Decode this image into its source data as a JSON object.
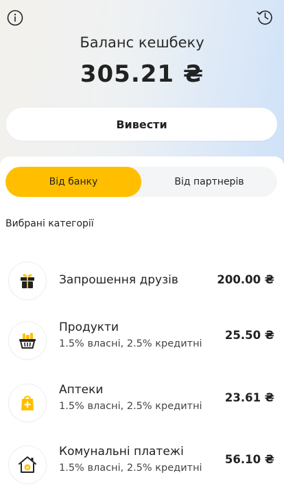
{
  "header": {
    "info_icon": "info-icon",
    "history_icon": "history-icon",
    "title": "Баланс кешбеку",
    "balance": "305.21 ₴",
    "withdraw_label": "Вивести"
  },
  "tabs": {
    "bank": "Від банку",
    "partners": "Від партнерів",
    "selected": "bank",
    "accent": "#ffbf00"
  },
  "section": {
    "title": "Вибрані категорії"
  },
  "categories": [
    {
      "icon": "gift-icon",
      "name": "Запрошення друзів",
      "sub": "",
      "amount": "200.00 ₴"
    },
    {
      "icon": "grocery-basket-icon",
      "name": "Продукти",
      "sub": "1.5% власні, 2.5% кредитні",
      "amount": "25.50 ₴"
    },
    {
      "icon": "pharmacy-bag-icon",
      "name": "Аптеки",
      "sub": "1.5% власні, 2.5% кредитні",
      "amount": "23.61 ₴"
    },
    {
      "icon": "house-utilities-icon",
      "name": "Комунальні платежі",
      "sub": "1.5% власні, 2.5% кредитні",
      "amount": "56.10 ₴"
    }
  ]
}
